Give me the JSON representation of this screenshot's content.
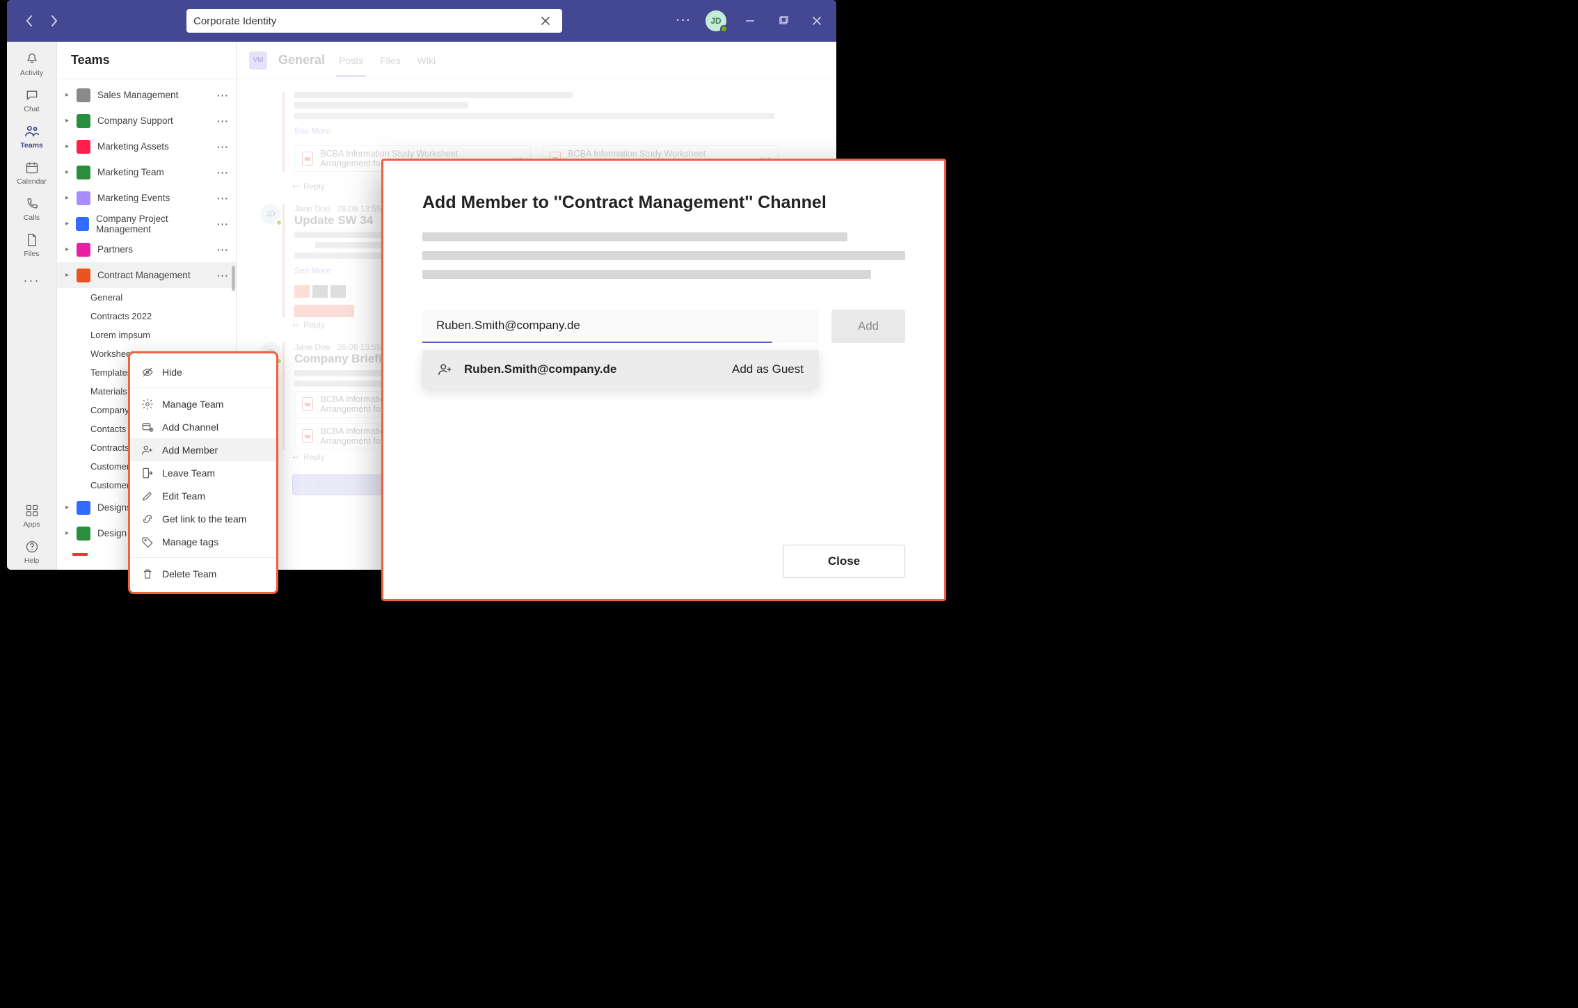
{
  "title_bar": {
    "search_value": "Corporate Identity",
    "avatar_initials": "JD"
  },
  "rail": {
    "items": [
      {
        "label": "Activity"
      },
      {
        "label": "Chat"
      },
      {
        "label": "Teams"
      },
      {
        "label": "Calendar"
      },
      {
        "label": "Calls"
      },
      {
        "label": "Files"
      }
    ],
    "bottom": [
      {
        "label": "Apps"
      },
      {
        "label": "Help"
      }
    ]
  },
  "sidebar": {
    "header": "Teams",
    "teams": [
      {
        "name": "Sales Management",
        "color": "#8a8a8a"
      },
      {
        "name": "Company Support",
        "color": "#2a8f3c"
      },
      {
        "name": "Marketing Assets",
        "color": "#ff1f4b"
      },
      {
        "name": "Marketing Team",
        "color": "#2a8f3c"
      },
      {
        "name": "Marketing Events",
        "color": "#a98cff"
      },
      {
        "name": "Company Project Management",
        "color": "#2f6cff"
      },
      {
        "name": "Partners",
        "color": "#e81ea6"
      },
      {
        "name": "Contract Management",
        "color": "#e8531e",
        "selected": true,
        "channels": [
          "General",
          "Contracts 2022",
          "Lorem impsum",
          "Worksheets",
          "Templates",
          "Materials",
          "Company Briefing",
          "Contacts & Partners",
          "Contracts 2021",
          "Customers A–M",
          "Customers M–Z"
        ]
      },
      {
        "name": "Designs",
        "color": "#2f6cff"
      },
      {
        "name": "Design Assets",
        "color": "#2a8f3c"
      }
    ]
  },
  "content": {
    "channel_tile": "VM",
    "channel_name": "General",
    "tabs": [
      "Posts",
      "Files",
      "Wiki"
    ],
    "see_more": "See More",
    "attachment_label": "BCBA Information Study Worksheet Arrangement fo...",
    "reply": "Reply",
    "post1": {
      "author": "Jane Doe",
      "time": "26.08 13:55",
      "title": "Update SW 34"
    },
    "post2": {
      "author": "Jane Doe",
      "time": "26.08 13:55",
      "title": "Company Briefing"
    },
    "att2_label": "BCBA Information Study Worksheet Arrangement fo..."
  },
  "context_menu": {
    "hide": "Hide",
    "manage": "Manage Team",
    "add_channel": "Add Channel",
    "add_member": "Add Member",
    "leave": "Leave Team",
    "edit": "Edit Team",
    "get_link": "Get link to the team",
    "tags": "Manage tags",
    "delete": "Delete Team"
  },
  "dialog": {
    "title": "Add Member to ''Contract Management'' Channel",
    "email_value": "Ruben.Smith@company.de",
    "add_label": "Add",
    "suggestion_email": "Ruben.Smith@company.de",
    "suggestion_action": "Add as Guest",
    "close_label": "Close"
  }
}
